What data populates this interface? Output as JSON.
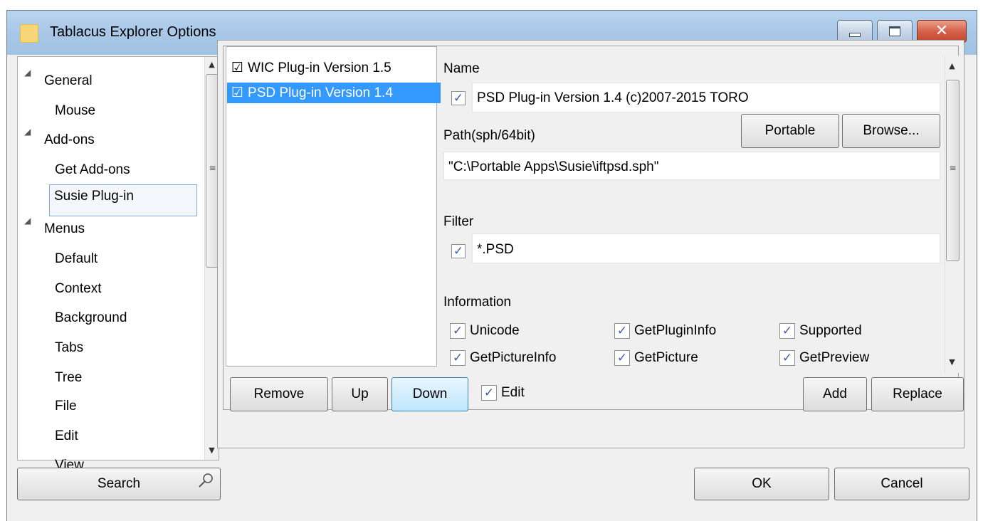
{
  "window": {
    "title": "Tablacus Explorer Options",
    "close_glyph": "✕"
  },
  "tree": {
    "items": [
      {
        "label": "General",
        "expanded": true
      },
      {
        "label": "Mouse"
      },
      {
        "label": "Add-ons",
        "expanded": true
      },
      {
        "label": "Get Add-ons"
      },
      {
        "label": "Susie Plug-in",
        "selected": true
      },
      {
        "label": "Menus",
        "expanded": true
      },
      {
        "label": "Default"
      },
      {
        "label": "Context"
      },
      {
        "label": "Background"
      },
      {
        "label": "Tabs"
      },
      {
        "label": "Tree"
      },
      {
        "label": "File"
      },
      {
        "label": "Edit"
      },
      {
        "label": "View"
      }
    ],
    "expander_glyph": "◢"
  },
  "scroll": {
    "up": "▲",
    "down": "▼",
    "grip": "≡"
  },
  "search": {
    "label": "Search",
    "icon": "magnifier-icon"
  },
  "plugins": {
    "check_glyph": "☑",
    "items": [
      {
        "label": "WIC Plug-in Version 1.5",
        "checked": true
      },
      {
        "label": "PSD Plug-in Version 1.4",
        "checked": true,
        "selected": true
      }
    ]
  },
  "details": {
    "name_label": "Name",
    "name_value": "PSD Plug-in Version 1.4 (c)2007-2015 TORO",
    "name_checked": true,
    "path_label": "Path(sph/64bit)",
    "path_value": "\"C:\\Portable Apps\\Susie\\iftpsd.sph\"",
    "portable_button": "Portable",
    "browse_button": "Browse...",
    "filter_label": "Filter",
    "filter_value": "*.PSD",
    "filter_checked": true,
    "information_label": "Information",
    "check_mark": "✓",
    "info_checks": [
      {
        "label": "Unicode",
        "checked": true
      },
      {
        "label": "GetPluginInfo",
        "checked": true
      },
      {
        "label": "Supported",
        "checked": true
      },
      {
        "label": "GetPictureInfo",
        "checked": true
      },
      {
        "label": "GetPicture",
        "checked": true
      },
      {
        "label": "GetPreview",
        "checked": true
      }
    ]
  },
  "list_actions": {
    "remove": "Remove",
    "up": "Up",
    "down": "Down",
    "edit_label": "Edit",
    "edit_checked": true,
    "add": "Add",
    "replace": "Replace"
  },
  "footer": {
    "ok": "OK",
    "cancel": "Cancel"
  },
  "colors": {
    "selection": "#3399ff",
    "titlebar": "#a9c8e8",
    "close": "#d6614a"
  }
}
